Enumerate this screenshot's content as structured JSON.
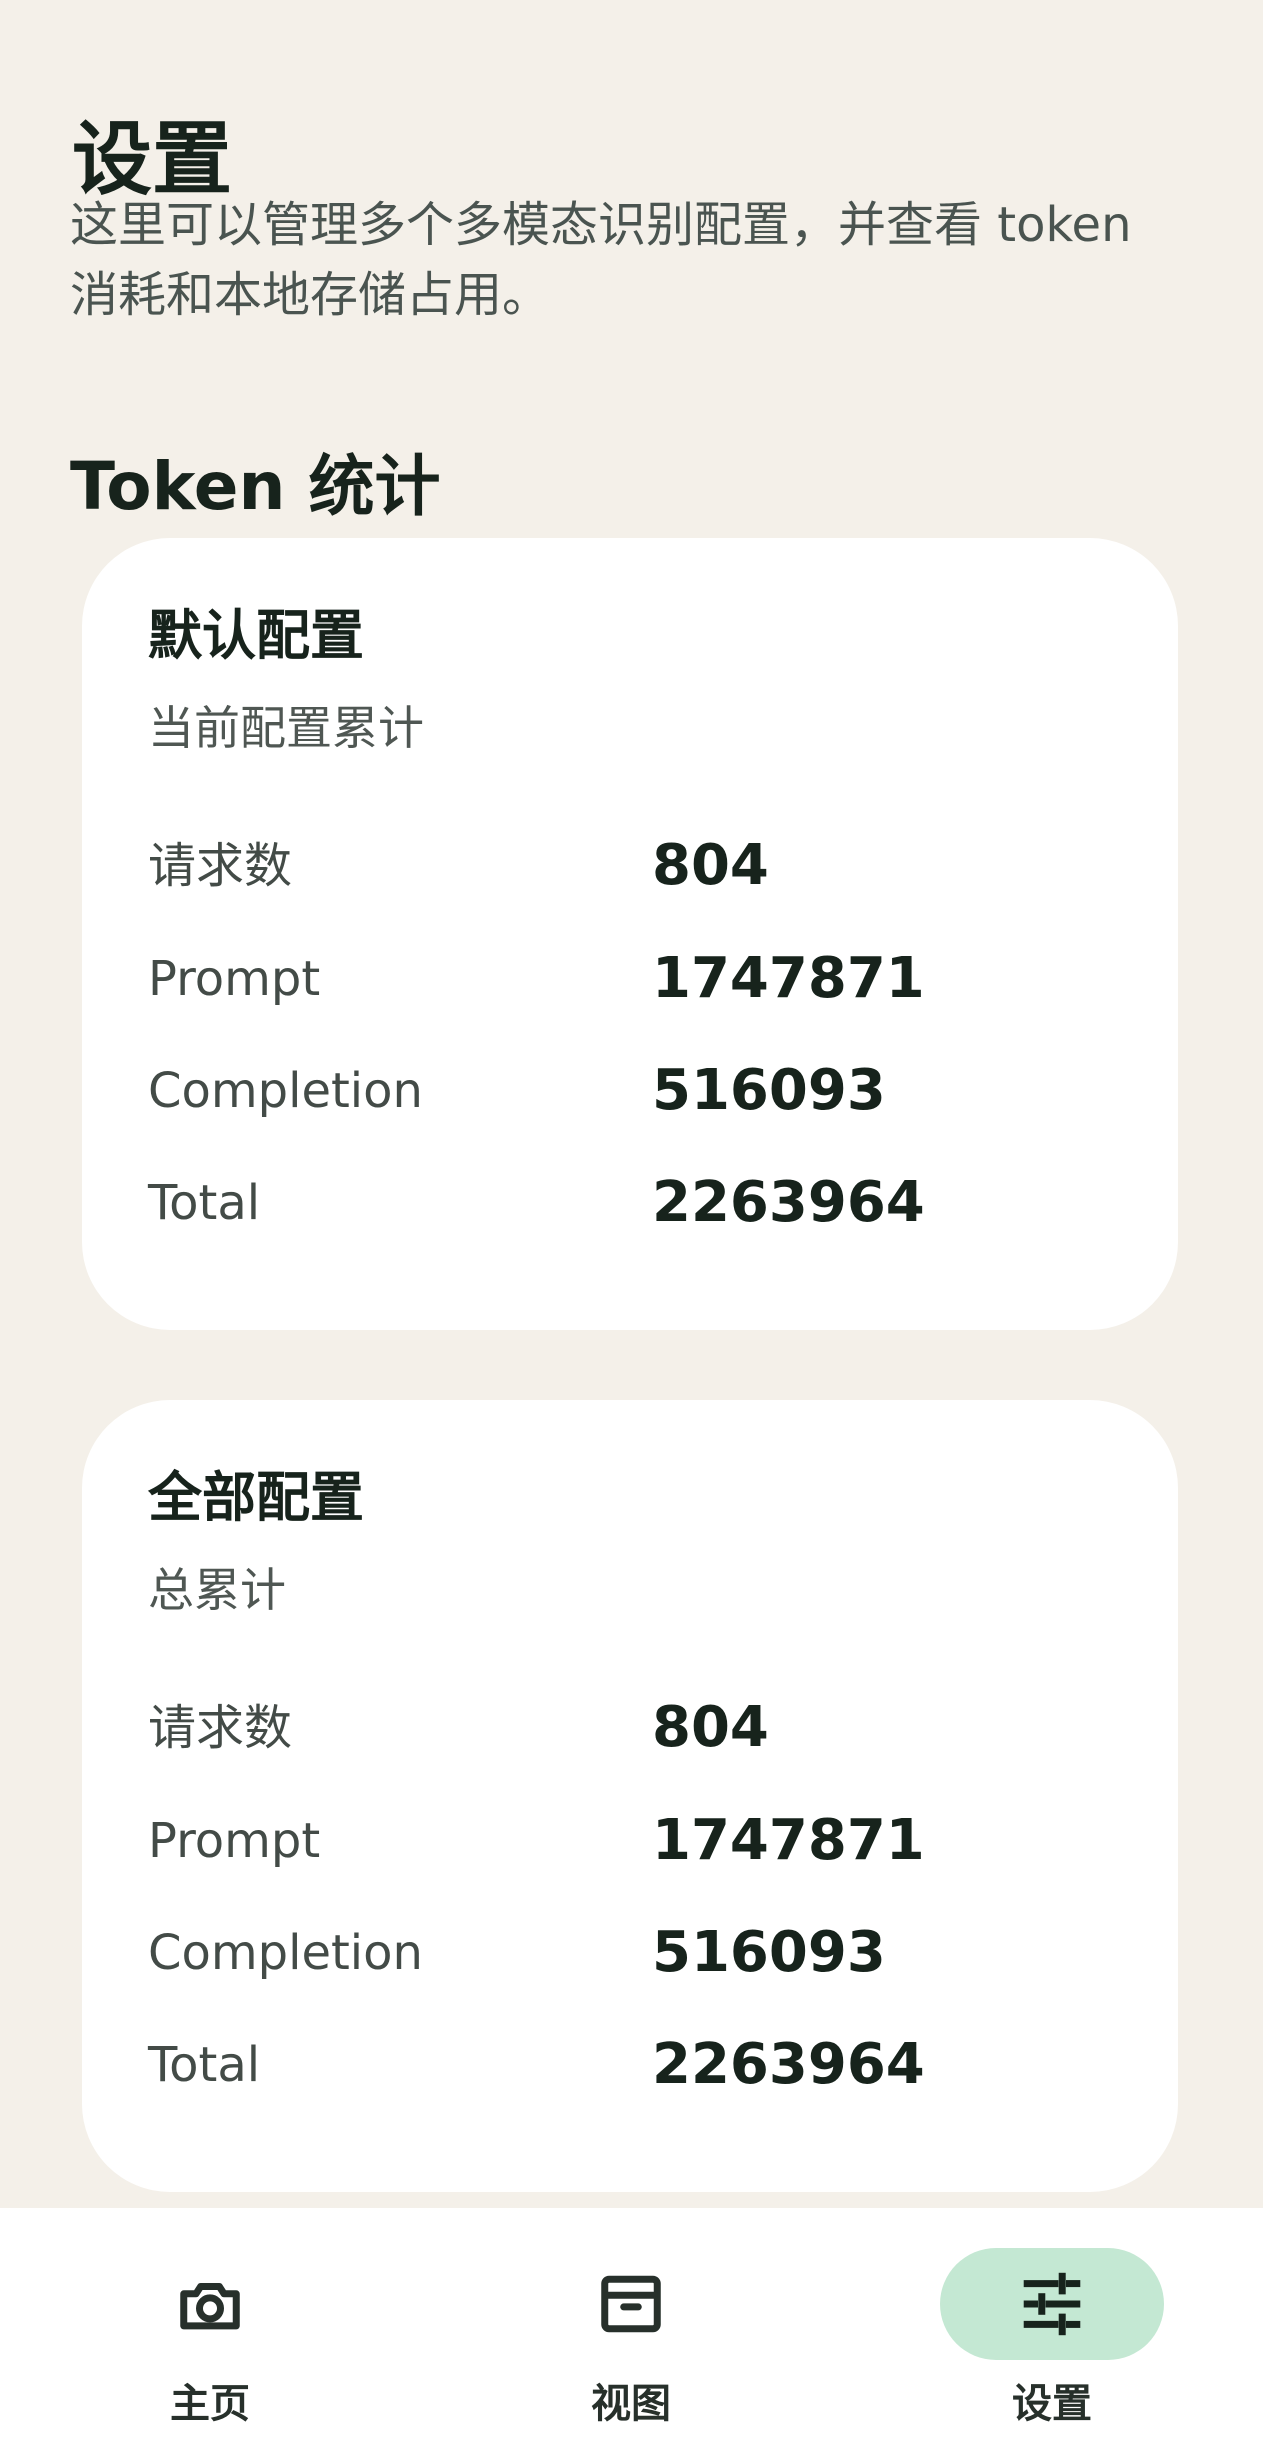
{
  "header": {
    "title": "设置",
    "description": "这里可以管理多个多模态识别配置，并查看 token 消耗和本地存储占用。"
  },
  "token_section": {
    "title": "Token 统计",
    "cards": [
      {
        "title": "默认配置",
        "subtitle": "当前配置累计",
        "stats": [
          {
            "label": "请求数",
            "value": "804"
          },
          {
            "label": "Prompt",
            "value": "1747871"
          },
          {
            "label": "Completion",
            "value": "516093"
          },
          {
            "label": "Total",
            "value": "2263964"
          }
        ]
      },
      {
        "title": "全部配置",
        "subtitle": "总累计",
        "stats": [
          {
            "label": "请求数",
            "value": "804"
          },
          {
            "label": "Prompt",
            "value": "1747871"
          },
          {
            "label": "Completion",
            "value": "516093"
          },
          {
            "label": "Total",
            "value": "2263964"
          }
        ]
      }
    ]
  },
  "bottom_nav": {
    "items": [
      {
        "label": "主页",
        "icon": "camera-icon",
        "active": false
      },
      {
        "label": "视图",
        "icon": "archive-icon",
        "active": false
      },
      {
        "label": "设置",
        "icon": "tune-icon",
        "active": true
      }
    ],
    "active_bg": "#c4e8d3"
  }
}
